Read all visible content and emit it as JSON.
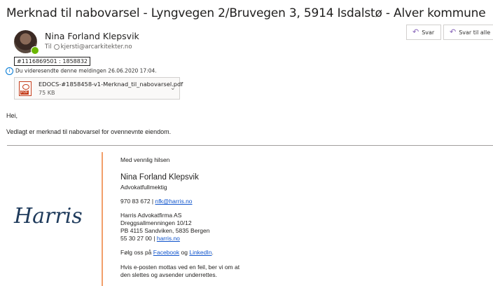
{
  "email": {
    "subject": "Merknad til nabovarsel - Lyngvegen 2/Bruvegen 3, 5914 Isdalstø - Alver kommune",
    "sender_name": "Nina Forland Klepsvik",
    "to_label": "Til",
    "to_address": "kjersti@arcarkitekter.no",
    "tag": "#1116869501 : 1858832",
    "forward_info": "Du videresendte denne meldingen 26.06.2020 17:04.",
    "attachment": {
      "filename": "EDOCS-#1858458-v1-Merknad_til_nabovarsel.pdf",
      "size": "75 KB",
      "icon": "pdf-file-icon"
    }
  },
  "actions": {
    "reply": "Svar",
    "reply_all": "Svar til alle"
  },
  "body": {
    "greeting": "Hei,",
    "message": "Vedlagt er merknad til nabovarsel for ovennevnte eiendom."
  },
  "signature": {
    "closing": "Med vennlig hilsen",
    "name": "Nina Forland Klepsvik",
    "title": "Advokatfullmektig",
    "phone": "970 83 672",
    "separator": " | ",
    "email": "nfk@harris.no",
    "company": "Harris Advokatfirma AS",
    "street": "Dreggsallmenningen 10/12",
    "postbox": "PB  4115 Sandviken, 5835 Bergen",
    "office_phone": "55 30 27 00",
    "website": "harris.no",
    "follow_prefix": "Følg oss på",
    "facebook": "Facebook",
    "and": "og",
    "linkedin": "LinkedIn",
    "period": ".",
    "disclaimer_line1": "Hvis e-posten mottas ved en feil, ber vi om at",
    "disclaimer_line2": "den slettes og avsender underrettes.",
    "logo_text": "Harris"
  },
  "colors": {
    "accent_line": "#f29f6b",
    "link": "#1155cc",
    "presence": "#6bb700",
    "reply_arrow": "#8764b8"
  }
}
